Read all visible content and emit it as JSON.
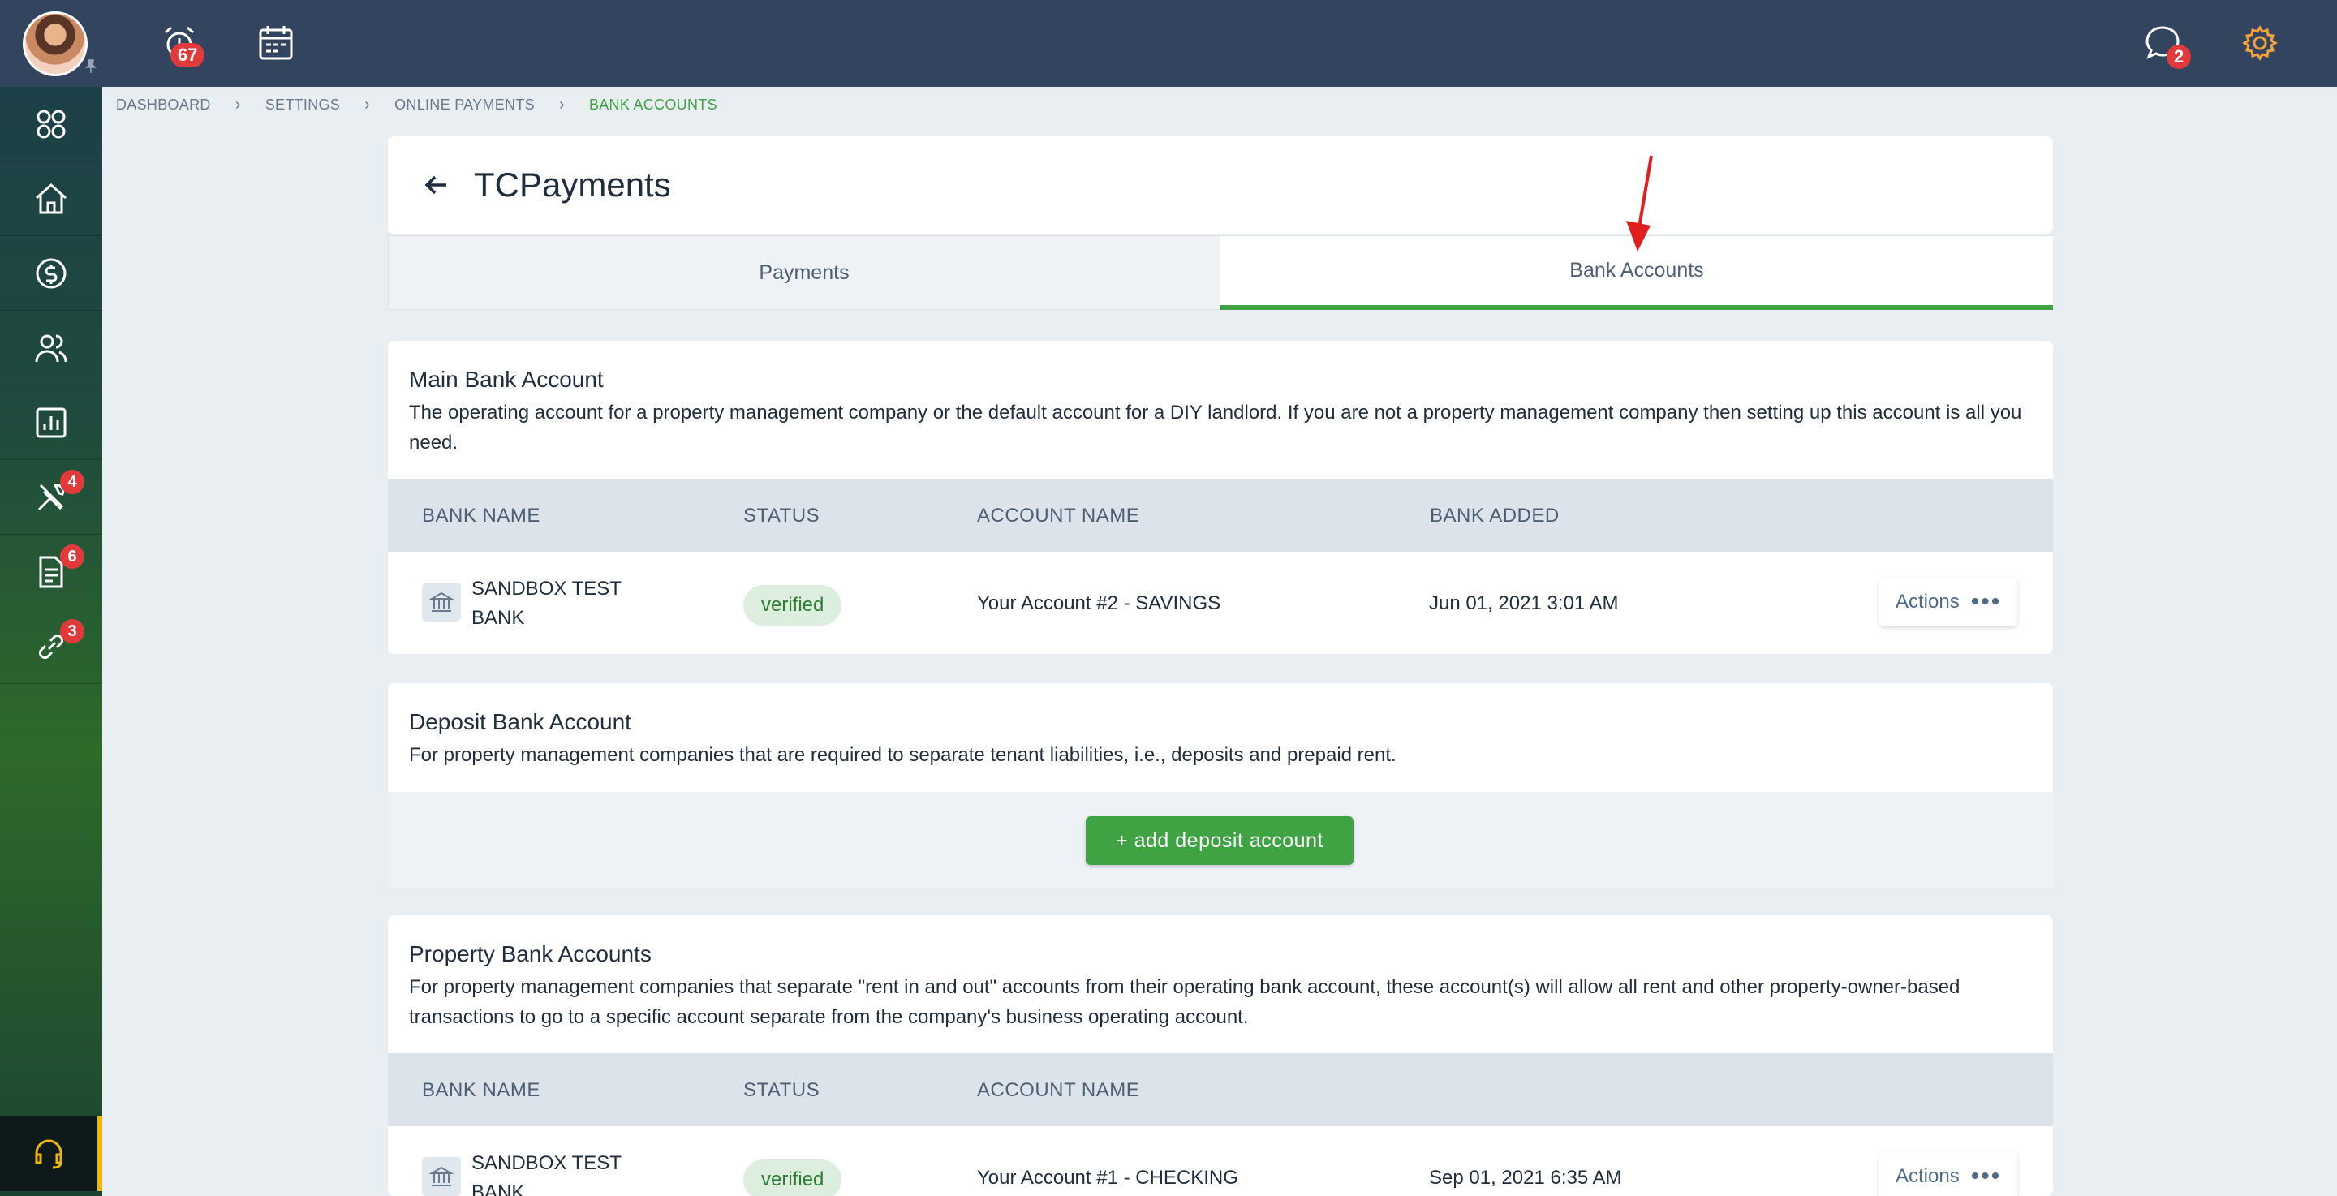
{
  "topbar": {
    "alerts_badge": "67",
    "messages_badge": "2"
  },
  "sidebar": {
    "items": [
      {
        "name": "apps",
        "badge": null
      },
      {
        "name": "home",
        "badge": null
      },
      {
        "name": "payments",
        "badge": null
      },
      {
        "name": "people",
        "badge": null
      },
      {
        "name": "reports",
        "badge": null
      },
      {
        "name": "maintenance",
        "badge": "4"
      },
      {
        "name": "documents",
        "badge": "6"
      },
      {
        "name": "links",
        "badge": "3"
      }
    ]
  },
  "breadcrumb": [
    "DASHBOARD",
    "SETTINGS",
    "ONLINE PAYMENTS",
    "BANK ACCOUNTS"
  ],
  "header": {
    "title": "TCPayments"
  },
  "tabs": [
    {
      "label": "Payments",
      "active": false
    },
    {
      "label": "Bank Accounts",
      "active": true
    }
  ],
  "main_account": {
    "title": "Main Bank Account",
    "description": "The operating account for a property management company or the default account for a DIY landlord. If you are not a property management company then setting up this account is all you need.",
    "columns": [
      "BANK NAME",
      "STATUS",
      "ACCOUNT NAME",
      "BANK ADDED"
    ],
    "rows": [
      {
        "bank_name": "SANDBOX TEST BANK",
        "status": "verified",
        "account_name": "Your Account #2 - SAVINGS",
        "added": "Jun 01, 2021 3:01 AM",
        "action": "Actions"
      }
    ]
  },
  "deposit_account": {
    "title": "Deposit Bank Account",
    "description": "For property management companies that are required to separate tenant liabilities, i.e., deposits and prepaid rent.",
    "button": "+ add deposit account"
  },
  "property_accounts": {
    "title": "Property Bank Accounts",
    "description": "For property management companies that separate \"rent in and out\" accounts from their operating bank account, these account(s) will allow all rent and other property-owner-based transactions to go to a specific account separate from the company's business operating account.",
    "columns": [
      "BANK NAME",
      "STATUS",
      "ACCOUNT NAME"
    ],
    "rows": [
      {
        "bank_name": "SANDBOX TEST BANK",
        "status": "verified",
        "account_name": "Your Account #1 - CHECKING",
        "added": "Sep 01, 2021 6:35 AM",
        "action": "Actions"
      }
    ]
  },
  "colors": {
    "accent": "#3fa344",
    "topbar": "#33455e",
    "badge": "#e23a3a",
    "settings_icon": "#f2a33a"
  }
}
